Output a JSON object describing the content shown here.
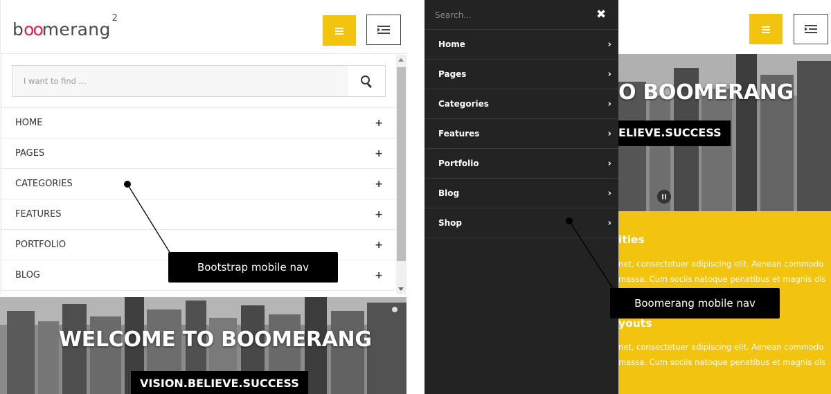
{
  "left_demo": {
    "logo": {
      "prefix": "b",
      "oo": "oo",
      "suffix": "merang",
      "sup": "2"
    },
    "search": {
      "placeholder": "I want to find ..."
    },
    "menu_items": [
      "HOME",
      "PAGES",
      "CATEGORIES",
      "FEATURES",
      "PORTFOLIO",
      "BLOG"
    ],
    "expand_symbol": "+",
    "hero": {
      "title": "WELCOME TO BOOMERANG",
      "tagline": "VISION.BELIEVE.SUCCESS"
    },
    "callout": "Bootstrap mobile nav"
  },
  "right_demo": {
    "drawer": {
      "search_placeholder": "Search...",
      "close_symbol": "✖",
      "items": [
        "Home",
        "Pages",
        "Categories",
        "Features",
        "Portfolio",
        "Blog",
        "Shop"
      ],
      "chevron": "›"
    },
    "hero": {
      "title_partial": "O BOOMERANG",
      "tagline_partial": "ELIEVE.SUCCESS"
    },
    "section1": {
      "heading": "ities",
      "line1": "net, consectetuer adipiscing elit. Aenean commodo",
      "line2": "massa. Cum sociis natoque penatibus et magnis dis"
    },
    "section2": {
      "heading": "youts",
      "line1": "net, consectetuer adipiscing elit. Aenean commodo",
      "line2": "massa. Cum sociis natoque penatibus et magnis dis"
    },
    "callout": "Boomerang mobile nav"
  },
  "colors": {
    "accent_yellow": "#f2c40f",
    "logo_red": "#e8204b",
    "drawer_bg": "#232323",
    "callout_bg": "#000000"
  },
  "icons": [
    "hamburger-icon",
    "indent-icon",
    "search-icon",
    "plus-icon",
    "close-icon",
    "chevron-right-icon",
    "pause-icon"
  ]
}
